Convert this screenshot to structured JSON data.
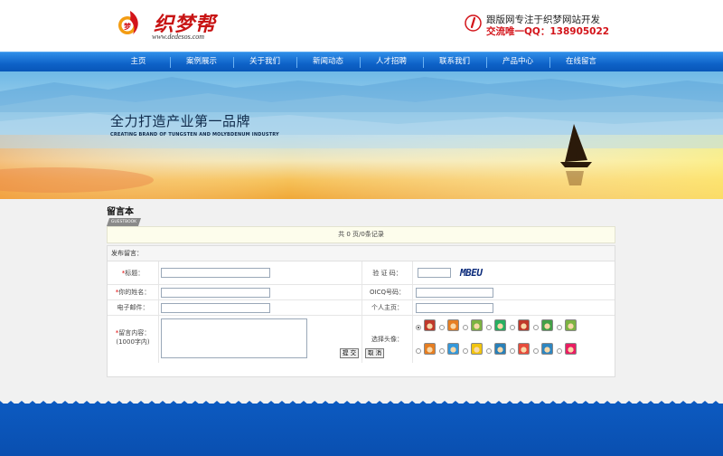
{
  "header": {
    "logo_name": "织梦帮",
    "logo_url": "www.dedesos.com",
    "contact_line1": "跟版网专注于织梦网站开发",
    "contact_line2": "交流唯一QQ：138905022"
  },
  "nav": {
    "items": [
      {
        "label": "主页"
      },
      {
        "label": "案例展示"
      },
      {
        "label": "关于我们"
      },
      {
        "label": "新闻动态"
      },
      {
        "label": "人才招聘"
      },
      {
        "label": "联系我们"
      },
      {
        "label": "产品中心"
      },
      {
        "label": "在线留言"
      }
    ]
  },
  "banner": {
    "slogan": "全力打造产业第一品牌",
    "slogan_en": "CREATING BRAND OF TUNGSTEN AND MOLYBDENUM INDUSTRY"
  },
  "page": {
    "title": "留言本",
    "tag": "GUESTBOOK",
    "pager_text": "共 0 页/0条记录"
  },
  "form": {
    "heading": "发布留言：",
    "title_label": "标题：",
    "captcha_label": "验 证 码：",
    "captcha_text": "MBEU",
    "name_label": "你的姓名：",
    "qq_label": "OICQ号码：",
    "email_label": "电子邮件：",
    "homepage_label": "个人主页：",
    "content_label": "留言内容：",
    "content_hint": "(1000字内)",
    "avatar_label": "选择头像：",
    "submit_label": "提 交",
    "reset_label": "取 消",
    "required_mark": "*"
  },
  "avatars": {
    "selected_index": 0,
    "colors": [
      "#c0392b",
      "#e67e22",
      "#7cb342",
      "#27ae60",
      "#c0392b",
      "#43a047",
      "#7cb342",
      "#e67e22",
      "#3498db",
      "#f1c40f",
      "#2980b9",
      "#e74c3c",
      "#2e86c1",
      "#e91e63"
    ]
  },
  "colors": {
    "nav_blue": "#0e62c8",
    "brand_red": "#c81414",
    "footer_blue": "#0a4fb4"
  }
}
